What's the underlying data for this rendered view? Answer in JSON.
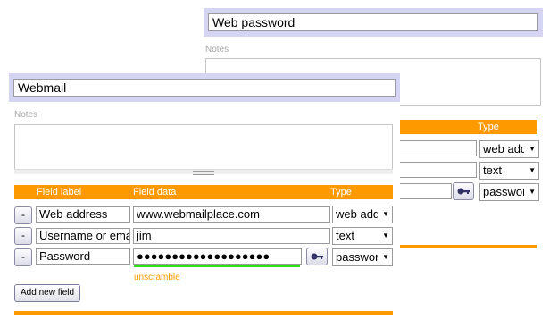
{
  "back_card": {
    "title_value": "Web password",
    "notes_label": "Notes",
    "table_header": {
      "type": "Type"
    },
    "rows": [
      {
        "type": "web address"
      },
      {
        "type": "text"
      },
      {
        "type": "password"
      }
    ],
    "key_icon": "key-icon"
  },
  "front_card": {
    "title_value": "Webmail",
    "notes_label": "Notes",
    "table_header": {
      "field_label": "Field label",
      "field_data": "Field data",
      "type": "Type"
    },
    "rows": [
      {
        "remove": "-",
        "label": "Web address",
        "data": "www.webmailplace.com",
        "type": "web address"
      },
      {
        "remove": "-",
        "label": "Username or email",
        "data": "jim",
        "type": "text"
      },
      {
        "remove": "-",
        "label": "Password",
        "data": "●●●●●●●●●●●●●●●●●●●",
        "type": "password"
      }
    ],
    "unscramble_label": "unscramble",
    "add_button_label": "Add new field",
    "key_icon": "key-icon"
  },
  "colors": {
    "accent": "#ff9900",
    "title_band": "#d5d5f3",
    "strength": "#33dd22"
  }
}
